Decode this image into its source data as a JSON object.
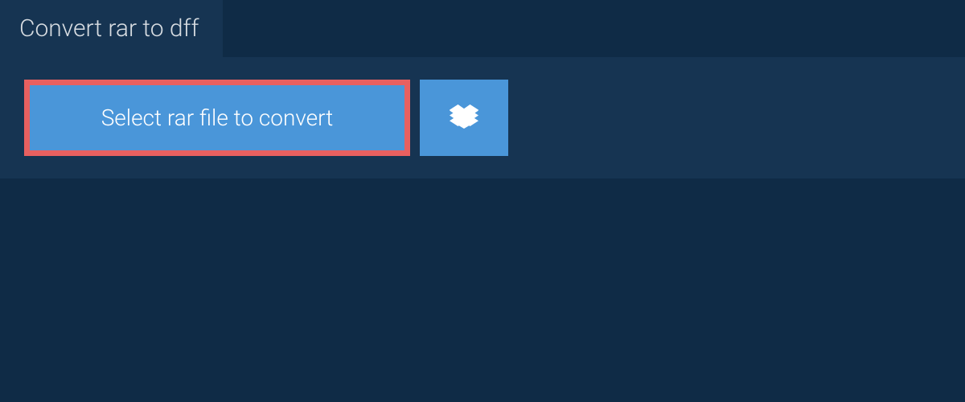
{
  "header": {
    "title": "Convert rar to dff"
  },
  "actions": {
    "select_label": "Select rar file to convert"
  }
}
